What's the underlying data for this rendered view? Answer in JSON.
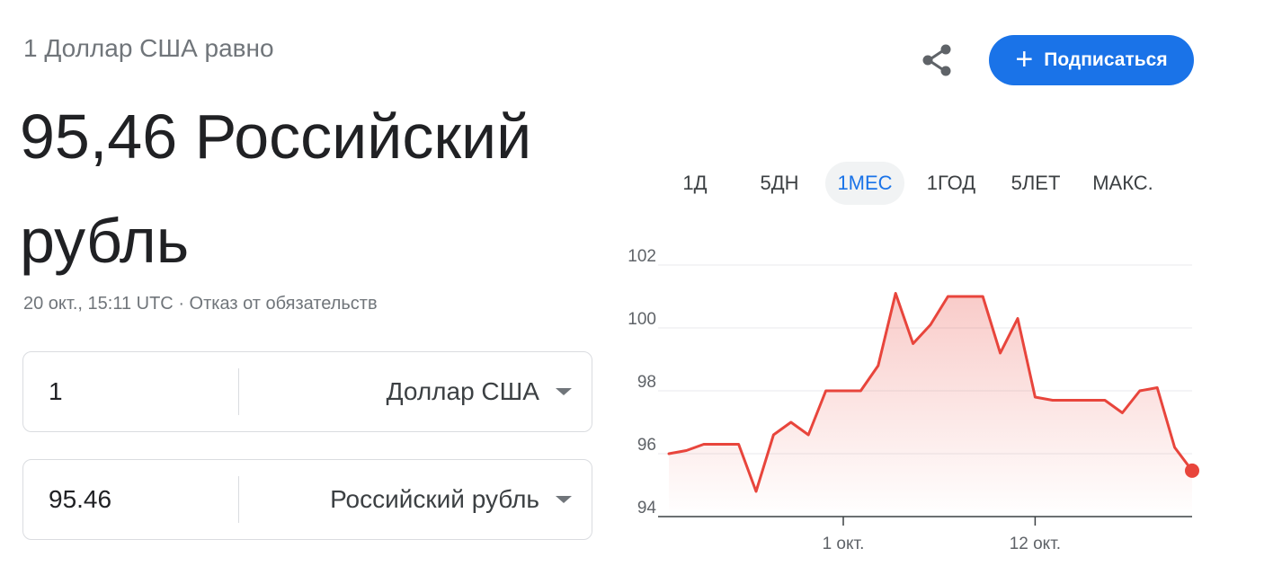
{
  "header": {
    "subtitle": "1 Доллар США равно",
    "value_line": "95,46 Российский рубль",
    "timestamp": "20 окт., 15:11 UTC",
    "separator": "·",
    "disclaimer": "Отказ от обязательств"
  },
  "actions": {
    "share_icon": "share-icon",
    "subscribe_icon": "plus-icon",
    "subscribe_plus": "+",
    "subscribe_label": "Подписаться",
    "accent_color": "#1a73e8"
  },
  "converter": {
    "from": {
      "value": "1",
      "currency": "Доллар США"
    },
    "to": {
      "value": "95.46",
      "currency": "Российский рубль"
    }
  },
  "tabs": [
    {
      "label": "1Д",
      "active": false
    },
    {
      "label": "5ДН",
      "active": false
    },
    {
      "label": "1МЕС",
      "active": true
    },
    {
      "label": "1ГОД",
      "active": false
    },
    {
      "label": "5ЛЕТ",
      "active": false
    },
    {
      "label": "МАКС.",
      "active": false
    }
  ],
  "chart_data": {
    "type": "area",
    "line_color": "#e8453c",
    "y_ticks": [
      "102",
      "100",
      "98",
      "96",
      "94"
    ],
    "ylim": [
      94,
      102
    ],
    "x_ticks": [
      "1 окт.",
      "12 окт."
    ],
    "points": [
      [
        0,
        96.0
      ],
      [
        1,
        96.1
      ],
      [
        2,
        96.3
      ],
      [
        3,
        96.3
      ],
      [
        4,
        96.3
      ],
      [
        5,
        94.8
      ],
      [
        6,
        96.6
      ],
      [
        7,
        97.0
      ],
      [
        8,
        96.6
      ],
      [
        9,
        98.0
      ],
      [
        10,
        98.0
      ],
      [
        11,
        98.0
      ],
      [
        12,
        98.8
      ],
      [
        13,
        101.1
      ],
      [
        14,
        99.5
      ],
      [
        15,
        100.1
      ],
      [
        16,
        101.0
      ],
      [
        17,
        101.0
      ],
      [
        18,
        101.0
      ],
      [
        19,
        99.2
      ],
      [
        20,
        100.3
      ],
      [
        21,
        97.8
      ],
      [
        22,
        97.7
      ],
      [
        23,
        97.7
      ],
      [
        24,
        97.7
      ],
      [
        25,
        97.7
      ],
      [
        26,
        97.3
      ],
      [
        27,
        98.0
      ],
      [
        28,
        98.1
      ],
      [
        29,
        96.2
      ],
      [
        30,
        95.46
      ]
    ]
  }
}
